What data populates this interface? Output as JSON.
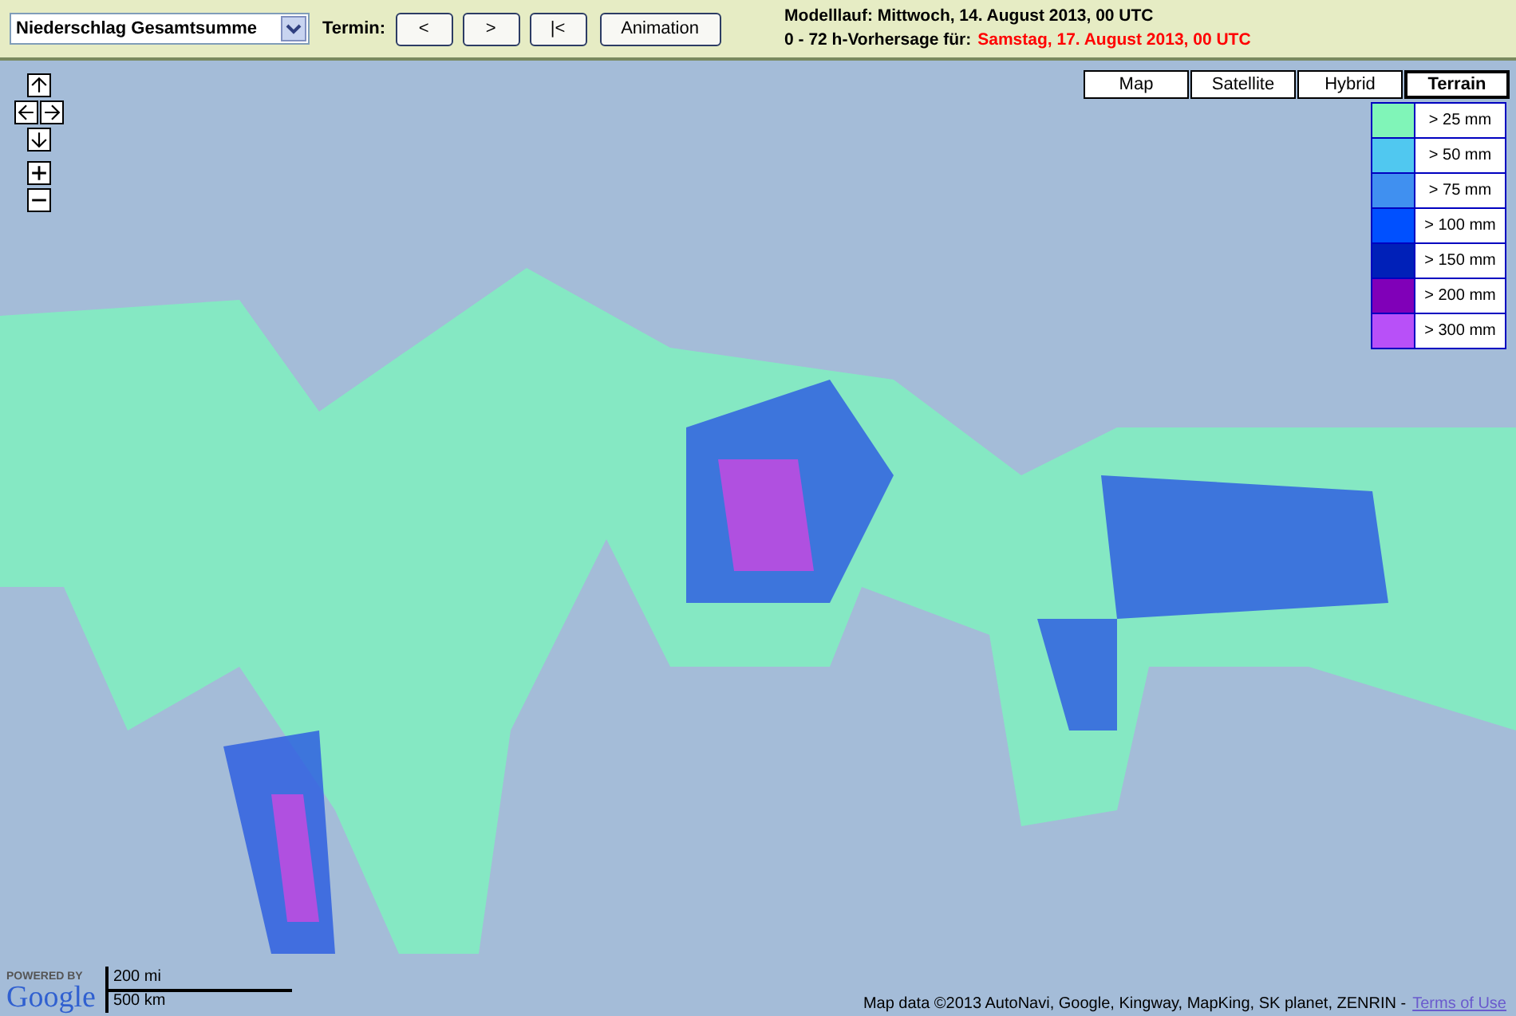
{
  "toolbar": {
    "product_select": {
      "value": "Niederschlag Gesamtsumme"
    },
    "termin_label": "Termin:",
    "buttons": [
      "<",
      ">",
      "|<",
      "Animation"
    ],
    "model_run": "Modelllauf: Mittwoch, 14. August 2013, 00 UTC",
    "forecast_label": "0 - 72 h-Vorhersage für:",
    "forecast_time": "Samstag, 17. August 2013, 00 UTC"
  },
  "map_types": [
    {
      "label": "Map",
      "selected": false
    },
    {
      "label": "Satellite",
      "selected": false
    },
    {
      "label": "Hybrid",
      "selected": false
    },
    {
      "label": "Terrain",
      "selected": true
    }
  ],
  "legend": [
    {
      "label": "> 25 mm",
      "color": "#80f5b8"
    },
    {
      "label": "> 50 mm",
      "color": "#50c8f0"
    },
    {
      "label": "> 75 mm",
      "color": "#4090f0"
    },
    {
      "label": "> 100 mm",
      "color": "#0050ff"
    },
    {
      "label": "> 150 mm",
      "color": "#0020b8"
    },
    {
      "label": "> 200 mm",
      "color": "#8000b8"
    },
    {
      "label": "> 300 mm",
      "color": "#b850f8"
    }
  ],
  "scale": {
    "miles": "200 mi",
    "km": "500 km"
  },
  "logo": {
    "powered_by": "POWERED BY",
    "name": "Google"
  },
  "attribution": {
    "text": "Map data ©2013 AutoNavi, Google, Kingway, MapKing, SK planet, ZENRIN -",
    "link": "Terms of Use"
  }
}
